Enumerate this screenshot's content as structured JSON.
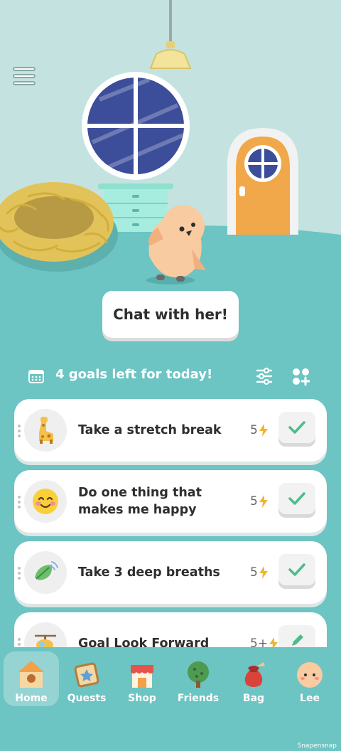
{
  "scene": {
    "chat_button": "Chat with her!"
  },
  "goals": {
    "header": "4 goals left for today!",
    "items": [
      {
        "title": "Take a stretch break",
        "energy": "5",
        "icon": "giraffe-icon",
        "action": "check"
      },
      {
        "title": "Do one thing that makes me happy",
        "energy": "5",
        "icon": "smiley-icon",
        "action": "check"
      },
      {
        "title": "Take 3 deep breaths",
        "energy": "5",
        "icon": "leaf-icon",
        "action": "check"
      },
      {
        "title": "Goal Look Forward",
        "energy": "5+",
        "icon": "helicopter-icon",
        "action": "edit"
      }
    ]
  },
  "nav": [
    {
      "label": "Home",
      "icon": "home-icon",
      "active": true
    },
    {
      "label": "Quests",
      "icon": "quests-icon"
    },
    {
      "label": "Shop",
      "icon": "shop-icon"
    },
    {
      "label": "Friends",
      "icon": "friends-icon"
    },
    {
      "label": "Bag",
      "icon": "bag-icon"
    },
    {
      "label": "Lee",
      "icon": "profile-icon"
    }
  ],
  "watermark": "Snapensnap",
  "colors": {
    "teal": "#6cc4c3",
    "wall": "#c4e3e0",
    "accent_check": "#4bbd8a",
    "energy": "#f2b531"
  }
}
